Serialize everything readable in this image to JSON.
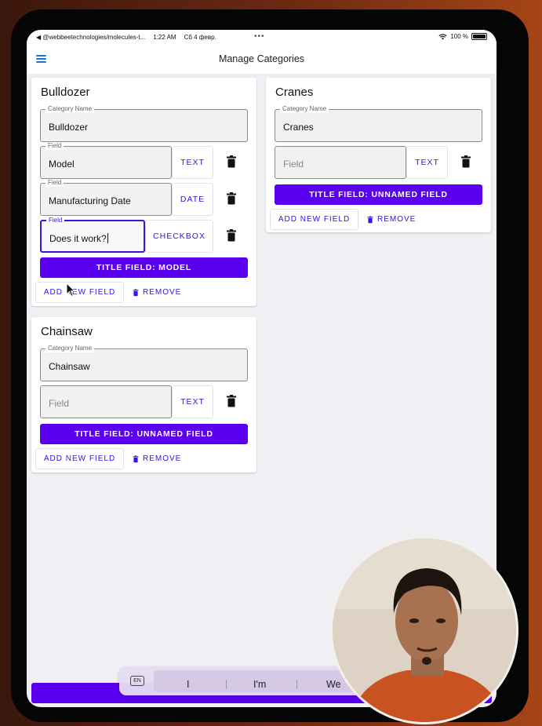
{
  "status_bar": {
    "back_app": "◀ @webbeetechnologies/molecules-t...",
    "time": "1:22 AM",
    "date": "Сб 4 февр.",
    "battery": "100 %"
  },
  "app_bar": {
    "title": "Manage Categories"
  },
  "categories": [
    {
      "title": "Bulldozer",
      "name_label": "Category Name",
      "name_value": "Bulldozer",
      "fields": [
        {
          "label": "Field",
          "value": "Model",
          "type": "TEXT"
        },
        {
          "label": "Field",
          "value": "Manufacturing Date",
          "type": "DATE"
        },
        {
          "label": "Field",
          "value": "Does it work?",
          "type": "CHECKBOX"
        }
      ],
      "title_field": "TITLE FIELD: MODEL",
      "add_label": "ADD NEW FIELD",
      "remove_label": "REMOVE"
    },
    {
      "title": "Cranes",
      "name_label": "Category Name",
      "name_value": "Cranes",
      "fields": [
        {
          "placeholder": "Field",
          "type": "TEXT"
        }
      ],
      "title_field": "TITLE FIELD: UNNAMED FIELD",
      "add_label": "ADD NEW FIELD",
      "remove_label": "REMOVE"
    },
    {
      "title": "Chainsaw",
      "name_label": "Category Name",
      "name_value": "Chainsaw",
      "fields": [
        {
          "placeholder": "Field",
          "type": "TEXT"
        }
      ],
      "title_field": "TITLE FIELD: UNNAMED FIELD",
      "add_label": "ADD NEW FIELD",
      "remove_label": "REMOVE"
    }
  ],
  "keyboard": {
    "lang": "EN",
    "suggestions": [
      "I",
      "I'm",
      "We"
    ]
  },
  "colors": {
    "primary": "#5a00ee",
    "accent_text": "#3d0fe0",
    "menu_icon": "#1976d2"
  }
}
